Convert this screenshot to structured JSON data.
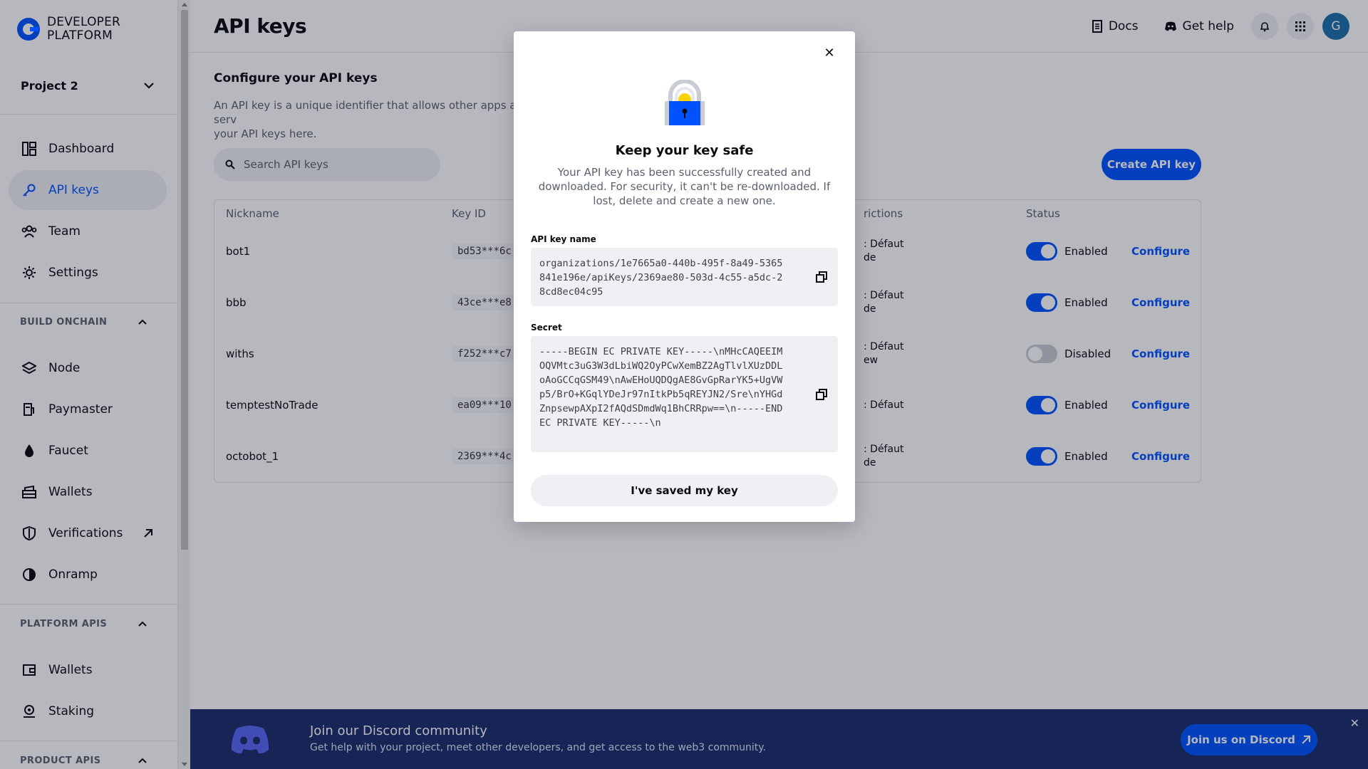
{
  "app": {
    "logo_line1": "DEVELOPER",
    "logo_line2": "PLATFORM"
  },
  "sidebar": {
    "project": "Project 2",
    "items": [
      {
        "label": "Dashboard",
        "icon": "dashboard-icon"
      },
      {
        "label": "API keys",
        "icon": "key-icon",
        "active": true
      },
      {
        "label": "Team",
        "icon": "team-icon"
      },
      {
        "label": "Settings",
        "icon": "gear-icon"
      }
    ],
    "build_onchain_label": "BUILD ONCHAIN",
    "build_items": [
      {
        "label": "Node",
        "icon": "layers-icon"
      },
      {
        "label": "Paymaster",
        "icon": "fuel-icon"
      },
      {
        "label": "Faucet",
        "icon": "drop-icon"
      },
      {
        "label": "Wallets",
        "icon": "wallet-stack-icon"
      },
      {
        "label": "Verifications",
        "icon": "shield-icon"
      },
      {
        "label": "Onramp",
        "icon": "onramp-icon"
      }
    ],
    "platform_apis_label": "PLATFORM APIS",
    "platform_items": [
      {
        "label": "Wallets",
        "icon": "wallet-icon"
      },
      {
        "label": "Staking",
        "icon": "staking-icon"
      }
    ],
    "product_apis_label": "PRODUCT APIS"
  },
  "header": {
    "title": "API keys",
    "docs": "Docs",
    "get_help": "Get help",
    "avatar": "G"
  },
  "main": {
    "section_title": "Configure your API keys",
    "section_desc_line1": "An API key is a unique identifier that allows other apps and serv",
    "section_desc_line2": "your API keys here.",
    "search_placeholder": "Search API keys",
    "create_button": "Create API key"
  },
  "table": {
    "headers": {
      "nickname": "Nickname",
      "key_id": "Key ID",
      "restrictions": "rictions",
      "status": "Status"
    },
    "rows": [
      {
        "nickname": "bot1",
        "key_id": "bd53***6c",
        "restr1": ": Défaut",
        "restr2": "de",
        "status": "Enabled",
        "enabled": true,
        "action": "Configure"
      },
      {
        "nickname": "bbb",
        "key_id": "43ce***e8",
        "restr1": ": Défaut",
        "restr2": "de",
        "status": "Enabled",
        "enabled": true,
        "action": "Configure"
      },
      {
        "nickname": "withs",
        "key_id": "f252***c7",
        "restr1": ": Défaut",
        "restr2": "ew",
        "status": "Disabled",
        "enabled": false,
        "action": "Configure"
      },
      {
        "nickname": "temptestNoTrade",
        "key_id": "ea09***10",
        "restr1": ": Défaut",
        "restr2": "",
        "status": "Enabled",
        "enabled": true,
        "action": "Configure"
      },
      {
        "nickname": "octobot_1",
        "key_id": "2369***4c",
        "restr1": ": Défaut",
        "restr2": "de",
        "status": "Enabled",
        "enabled": true,
        "action": "Configure"
      }
    ]
  },
  "discord": {
    "title": "Join our Discord community",
    "subtitle": "Get help with your project, meet other developers, and get access to the web3 community.",
    "button": "Join us on Discord"
  },
  "modal": {
    "title": "Keep your key safe",
    "description": "Your API key has been successfully created and downloaded. For security, it can't be re-downloaded. If lost, delete and create a new one.",
    "name_label": "API key name",
    "name_value": "organizations/1e7665a0-440b-495f-8a49-5365841e196e/apiKeys/2369ae80-503d-4c55-a5dc-28cd8ec04c95",
    "secret_label": "Secret",
    "secret_value": "-----BEGIN EC PRIVATE KEY-----\\nMHcCAQEEIMOQVMtc3uG3W3dLbiWQ2OyPCwXemBZ2AgTlvlXUzDDLoAoGCCqGSM49\\nAwEHoUQDQgAE8GvGpRarYK5+UgVWp5/BrO+KGqlYDeJr97nItkPb5qREYJN2/Sre\\nYHGdZnpsewpAXpI2fAQdSDmdWq1BhCRRpw==\\n-----END EC PRIVATE KEY-----\\n",
    "saved_button": "I've saved my key"
  },
  "colors": {
    "brand": "#0052ff",
    "discord_banner": "#1a2b6b",
    "muted_text": "#5b616e"
  }
}
